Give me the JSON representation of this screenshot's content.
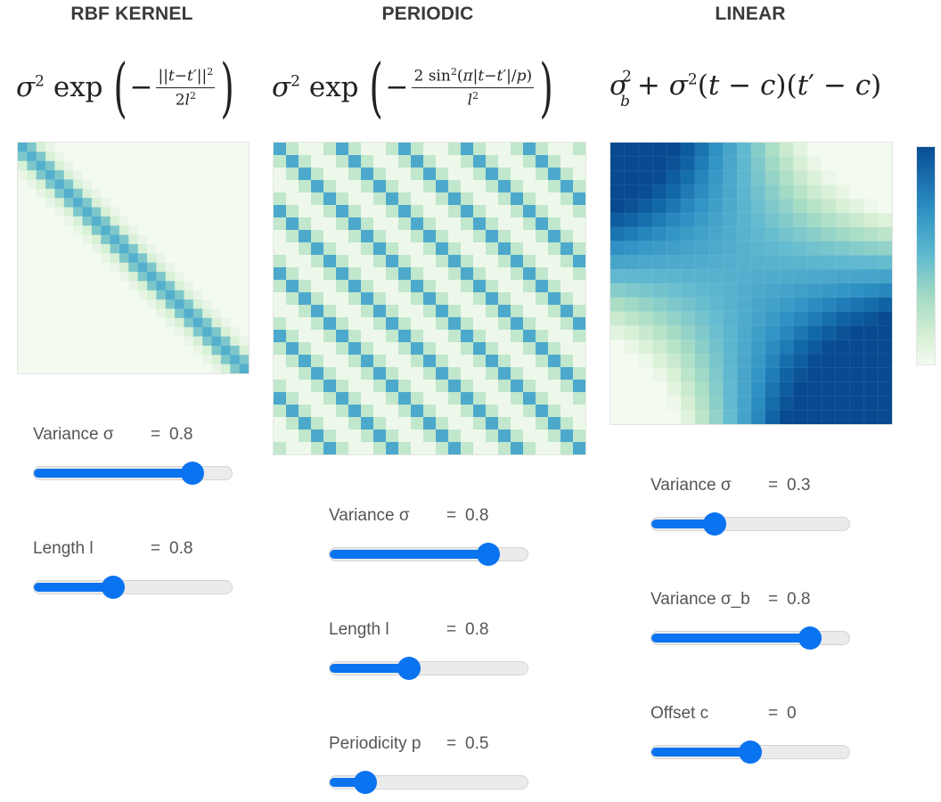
{
  "colors": {
    "accent": "#0a73f0",
    "scale_low": "#f3faf0",
    "scale_high": "#084d96"
  },
  "panels": [
    {
      "title": "RBF KERNEL",
      "kernel": "rbf",
      "controls": [
        {
          "name": "Variance σ",
          "eq": "=",
          "value": "0.8",
          "fraction": 0.8
        },
        {
          "name": "Length l",
          "eq": "=",
          "value": "0.8",
          "fraction": 0.4
        }
      ]
    },
    {
      "title": "PERIODIC",
      "kernel": "periodic",
      "controls": [
        {
          "name": "Variance σ",
          "eq": "=",
          "value": "0.8",
          "fraction": 0.8
        },
        {
          "name": "Length l",
          "eq": "=",
          "value": "0.8",
          "fraction": 0.4
        },
        {
          "name": "Periodicity p",
          "eq": "=",
          "value": "0.5",
          "fraction": 0.18
        }
      ]
    },
    {
      "title": "LINEAR",
      "kernel": "linear",
      "controls": [
        {
          "name": "Variance σ",
          "eq": "=",
          "value": "0.3",
          "fraction": 0.32
        },
        {
          "name": "Variance σ_b",
          "eq": "=",
          "value": "0.8",
          "fraction": 0.8
        },
        {
          "name": "Offset c",
          "eq": "=",
          "value": "0",
          "fraction": 0.5
        }
      ]
    }
  ]
}
